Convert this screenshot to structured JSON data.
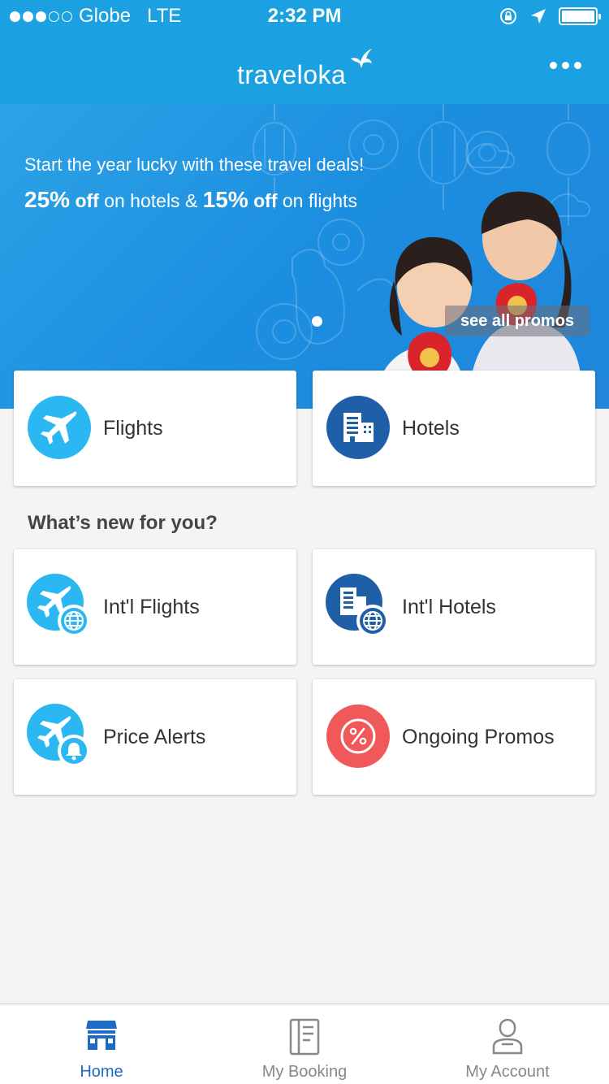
{
  "status_bar": {
    "carrier": "Globe",
    "network": "LTE",
    "time": "2:32 PM"
  },
  "header": {
    "logo_text": "traveloka"
  },
  "banner": {
    "headline": "Start the year lucky with these travel deals!",
    "hotel_discount": "25%",
    "off_word_1": "off",
    "hotel_text": "on hotels &",
    "flight_discount": "15%",
    "off_word_2": "off",
    "flight_text": "on flights",
    "see_all_label": "see all promos"
  },
  "main_products": [
    {
      "label": "Flights",
      "icon": "plane-icon"
    },
    {
      "label": "Hotels",
      "icon": "building-icon"
    }
  ],
  "whats_new": {
    "title": "What’s new for you?",
    "items": [
      {
        "label": "Int'l Flights",
        "icon": "intl-flights-icon"
      },
      {
        "label": "Int'l Hotels",
        "icon": "intl-hotels-icon"
      },
      {
        "label": "Price Alerts",
        "icon": "price-alert-icon"
      },
      {
        "label": "Ongoing Promos",
        "icon": "promo-percent-icon"
      }
    ]
  },
  "tabbar": {
    "items": [
      {
        "label": "Home",
        "icon": "home-icon",
        "active": true
      },
      {
        "label": "My Booking",
        "icon": "booking-icon",
        "active": false
      },
      {
        "label": "My Account",
        "icon": "account-icon",
        "active": false
      }
    ]
  },
  "colors": {
    "brand_blue": "#1ba0e1",
    "light_blue_icon": "#2bb7f2",
    "dark_blue_icon": "#1f5fa8",
    "promo_red": "#f0585a",
    "active_tab": "#1e6bc6"
  }
}
